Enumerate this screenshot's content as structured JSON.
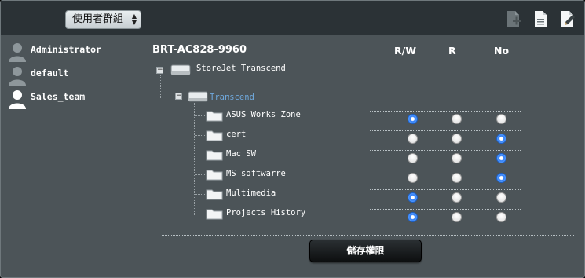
{
  "toolbar": {
    "group_select_value": "使用者群組",
    "icons": [
      "add-folder-icon",
      "document-icon",
      "edit-icon"
    ]
  },
  "users": [
    {
      "name": "Administrator",
      "selected": false
    },
    {
      "name": "default",
      "selected": false
    },
    {
      "name": "Sales_team",
      "selected": true
    }
  ],
  "device": {
    "name": "BRT-AC828-9960",
    "drive_label": "StoreJet Transcend",
    "partition_label": "Transcend"
  },
  "columns": {
    "rw": "R/W",
    "r": "R",
    "no": "No"
  },
  "folders": [
    {
      "name": "ASUS Works Zone",
      "permission": "rw"
    },
    {
      "name": "cert",
      "permission": "no"
    },
    {
      "name": "Mac SW",
      "permission": "no"
    },
    {
      "name": "MS softwarre",
      "permission": "no"
    },
    {
      "name": "Multimedia",
      "permission": "rw"
    },
    {
      "name": "Projects History",
      "permission": "rw"
    }
  ],
  "save_button_label": "儲存權限",
  "colors": {
    "panel": "#4c5458",
    "topbar": "#2b3236",
    "partition_link": "#6fa8dc",
    "radio_selected": "#2f7df6"
  }
}
